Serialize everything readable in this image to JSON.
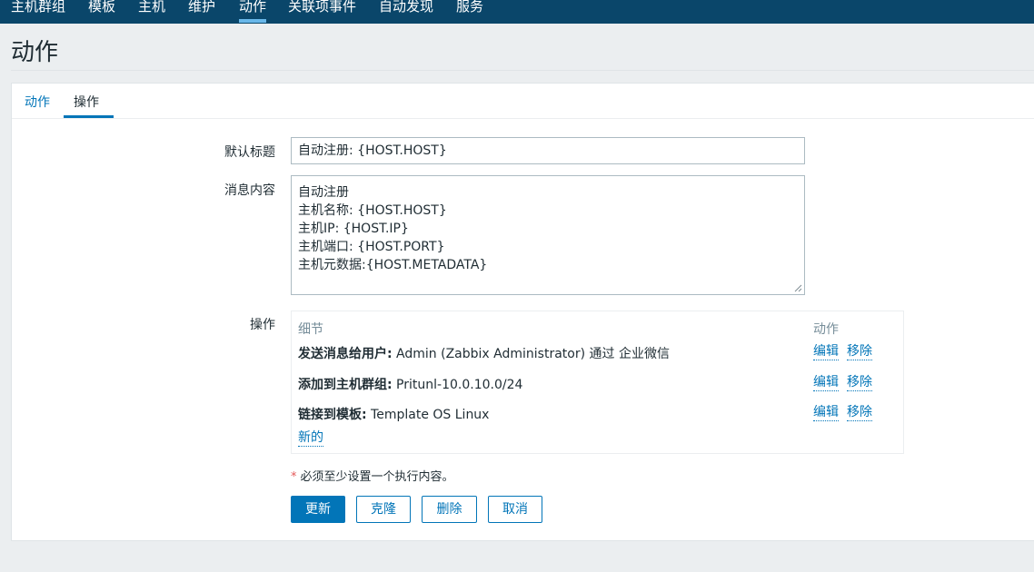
{
  "nav": {
    "items": [
      {
        "label": "主机群组"
      },
      {
        "label": "模板"
      },
      {
        "label": "主机"
      },
      {
        "label": "维护"
      },
      {
        "label": "动作",
        "active": true
      },
      {
        "label": "关联项事件"
      },
      {
        "label": "自动发现"
      },
      {
        "label": "服务"
      }
    ]
  },
  "page": {
    "title": "动作"
  },
  "tabs": [
    {
      "label": "动作"
    },
    {
      "label": "操作",
      "selected": true
    }
  ],
  "form": {
    "default_subject_label": "默认标题",
    "default_subject_value": "自动注册: {HOST.HOST}",
    "message_label": "消息内容",
    "message_lines": [
      "自动注册",
      "主机名称: {HOST.HOST}",
      "主机IP: {HOST.IP}",
      "主机端口: {HOST.PORT}",
      "主机元数据:{HOST.METADATA}"
    ],
    "operations_label": "操作"
  },
  "operations": {
    "col_details": "细节",
    "col_action": "动作",
    "rows": [
      {
        "label": "发送消息给用户:",
        "text": " Admin (Zabbix Administrator) 通过 企业微信",
        "edit": "编辑",
        "remove": "移除"
      },
      {
        "label": "添加到主机群组:",
        "text": " Pritunl-10.0.10.0/24",
        "edit": "编辑",
        "remove": "移除"
      },
      {
        "label": "链接到模板:",
        "text": " Template OS Linux",
        "edit": "编辑",
        "remove": "移除"
      }
    ],
    "new_label": "新的"
  },
  "hint": {
    "star": "*",
    "text": "必须至少设置一个执行内容。"
  },
  "buttons": {
    "update": "更新",
    "clone": "克隆",
    "delete": "删除",
    "cancel": "取消"
  },
  "colors": {
    "nav_bg": "#0a466a",
    "accent": "#0275b8",
    "nav_active": "#69b7e9",
    "required": "#e45959"
  }
}
